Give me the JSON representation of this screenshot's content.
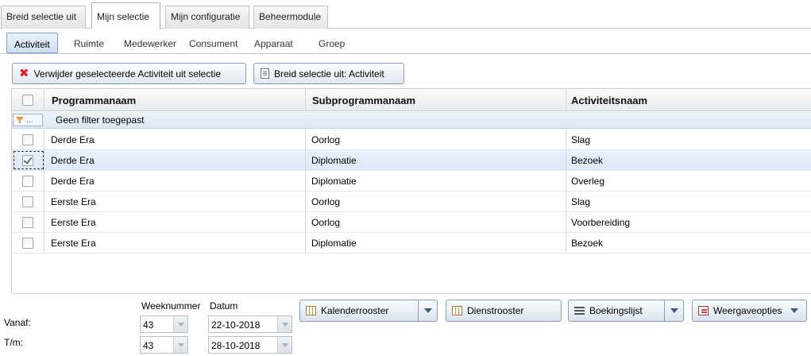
{
  "top_tabs": [
    "Breid selectie uit",
    "Mijn selectie",
    "Mijn configuratie",
    "Beheermodule"
  ],
  "sub_tabs": [
    "Activiteit",
    "Ruimte",
    "Medewerker",
    "Consument",
    "Apparaat",
    "Groep"
  ],
  "actions": {
    "remove_label": "Verwijder geselecteerde Activiteit uit selectie",
    "extend_label": "Breid selectie uit: Activiteit"
  },
  "grid": {
    "columns": [
      "Programmanaam",
      "Subprogrammanaam",
      "Activiteitsnaam"
    ],
    "filter_button": "...",
    "filter_text": "Geen filter toegepast",
    "rows": [
      {
        "program": "Derde Era",
        "subprogram": "Oorlog",
        "activity": "Slag",
        "checked": false
      },
      {
        "program": "Derde Era",
        "subprogram": "Diplomatie",
        "activity": "Bezoek",
        "checked": true
      },
      {
        "program": "Derde Era",
        "subprogram": "Diplomatie",
        "activity": "Overleg",
        "checked": false
      },
      {
        "program": "Eerste Era",
        "subprogram": "Oorlog",
        "activity": "Slag",
        "checked": false
      },
      {
        "program": "Eerste Era",
        "subprogram": "Oorlog",
        "activity": "Voorbereiding",
        "checked": false
      },
      {
        "program": "Eerste Era",
        "subprogram": "Diplomatie",
        "activity": "Bezoek",
        "checked": false
      }
    ]
  },
  "period": {
    "week_header": "Weeknummer",
    "date_header": "Datum",
    "from_label": "Vanaf:",
    "to_label": "T/m:",
    "from_week": "43",
    "from_date": "22-10-2018",
    "to_week": "43",
    "to_date": "28-10-2018"
  },
  "bottom_buttons": {
    "calendar": "Kalenderrooster",
    "service": "Dienstrooster",
    "bookings": "Boekingslijst",
    "display": "Weergaveopties"
  },
  "colors": {
    "accent": "#7fa4cc",
    "selected_row": "#dbe8f6",
    "remove_icon": "#dd2222"
  },
  "icons": {
    "remove": "x-icon",
    "extend": "document-icon",
    "filter": "filter-icon",
    "calendar": "calendar-icon",
    "service": "calendar-icon",
    "bookings": "list-icon",
    "display": "options-icon"
  }
}
